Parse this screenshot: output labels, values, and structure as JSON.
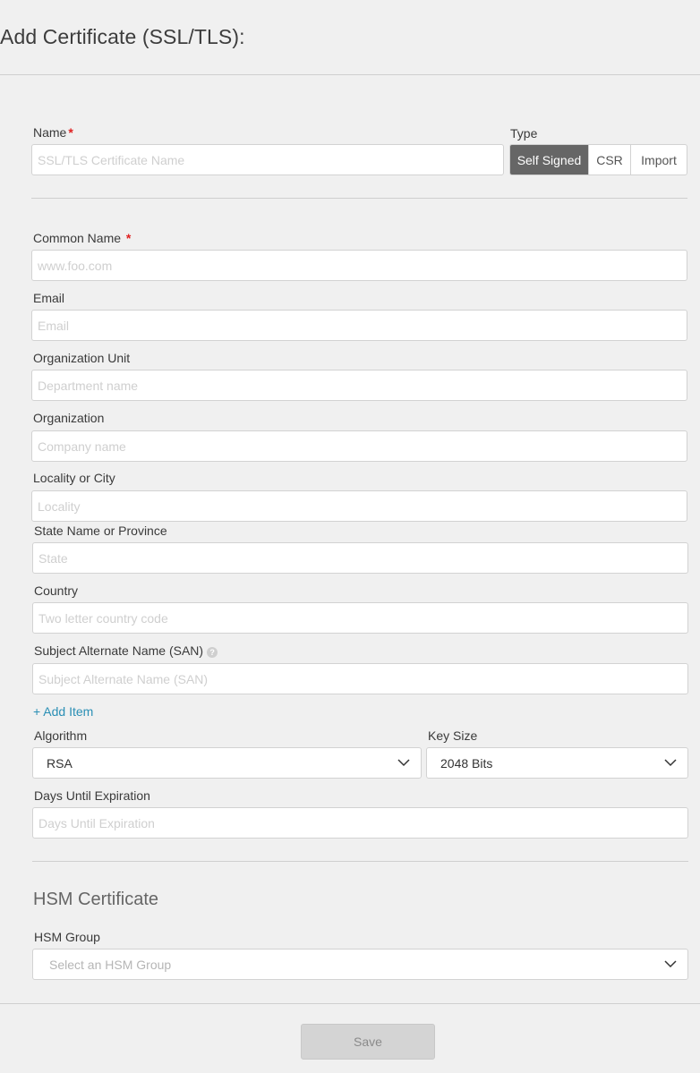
{
  "page": {
    "title": "Add Certificate (SSL/TLS):"
  },
  "name_field": {
    "label": "Name",
    "required_mark": "*",
    "placeholder": "SSL/TLS Certificate Name",
    "value": ""
  },
  "type": {
    "label": "Type",
    "options": [
      {
        "label": "Self Signed",
        "active": true
      },
      {
        "label": "CSR",
        "active": false
      },
      {
        "label": "Import",
        "active": false
      }
    ]
  },
  "common_name": {
    "label": "Common Name",
    "required_mark": "*",
    "placeholder": "www.foo.com"
  },
  "email": {
    "label": "Email",
    "placeholder": "Email"
  },
  "org_unit": {
    "label": "Organization Unit",
    "placeholder": "Department name"
  },
  "organization": {
    "label": "Organization",
    "placeholder": "Company name"
  },
  "locality": {
    "label": "Locality or City",
    "placeholder": "Locality"
  },
  "state": {
    "label": "State Name or Province",
    "placeholder": "State"
  },
  "country": {
    "label": "Country",
    "placeholder": "Two letter country code"
  },
  "san": {
    "label": "Subject Alternate Name (SAN)",
    "help_icon": "question-circle-icon",
    "placeholder": "Subject Alternate Name (SAN)",
    "add_item": "+ Add Item"
  },
  "algorithm": {
    "label": "Algorithm",
    "value": "RSA",
    "icon": "chevron-down-icon"
  },
  "key_size": {
    "label": "Key Size",
    "value": "2048 Bits",
    "icon": "chevron-down-icon"
  },
  "days": {
    "label": "Days Until Expiration",
    "placeholder": "Days Until Expiration"
  },
  "hsm": {
    "section_title": "HSM Certificate",
    "group_label": "HSM Group",
    "group_placeholder": "Select an HSM Group",
    "icon": "chevron-down-icon"
  },
  "footer": {
    "save_label": "Save"
  },
  "colors": {
    "background": "#f0f0f0",
    "active_segment": "#666666",
    "required": "#e02020",
    "link": "#2a8fb5"
  }
}
